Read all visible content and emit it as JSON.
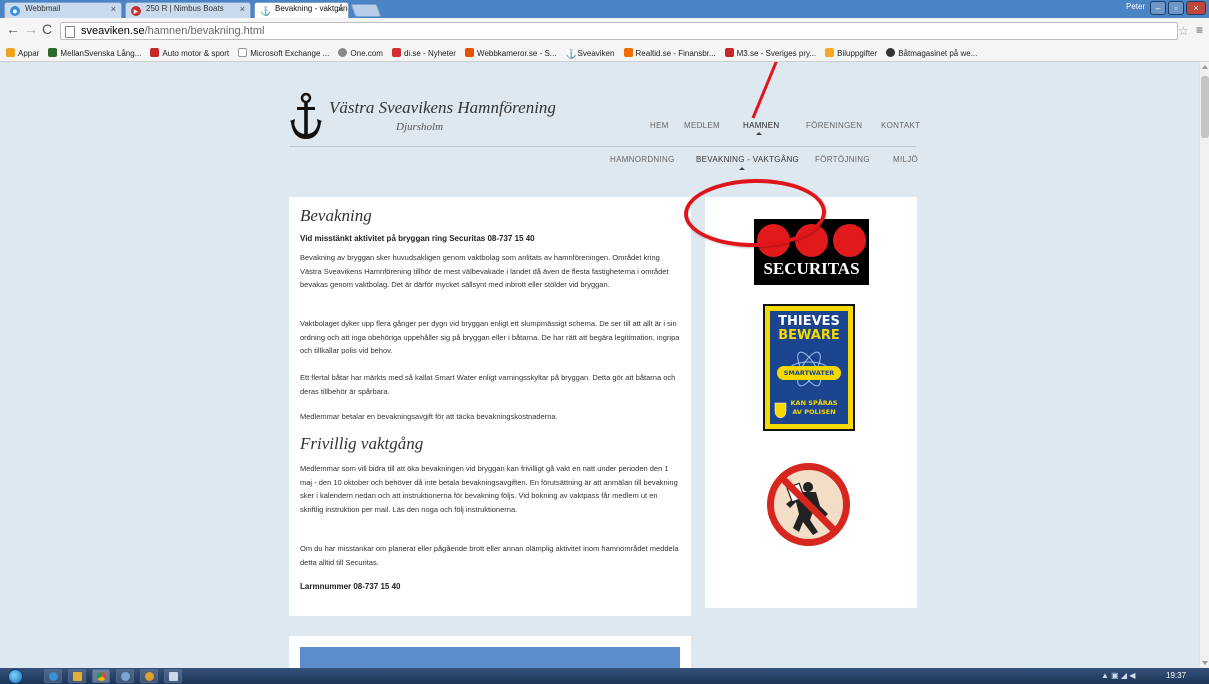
{
  "browser": {
    "tabs": [
      {
        "label": "Webbmail",
        "active": false
      },
      {
        "label": "250 R | Nimbus Boats",
        "active": false
      },
      {
        "label": "Bevakning - vaktgång",
        "active": true
      }
    ],
    "window_user": "Peter",
    "url_domain": "sveaviken.se",
    "url_path": "/hamnen/bevakning.html",
    "bookmarks": [
      "Appar",
      "MellanSvenska Lång...",
      "Auto motor & sport",
      "Microsoft Exchange ...",
      "One.com",
      "di.se - Nyheter",
      "Webbkameror.se - S...",
      "Sveaviken",
      "Realtid.se - Finansbr...",
      "M3.se - Sveriges pry...",
      "Biluppgifter",
      "Båtmagasinet på we..."
    ]
  },
  "site": {
    "title": "Västra Sveavikens Hamnförening",
    "subtitle": "Djursholm",
    "nav": [
      "HEM",
      "MEDLEM",
      "HAMNEN",
      "FÖRENINGEN",
      "KONTAKT"
    ],
    "subnav": [
      "HAMNORDNING",
      "BEVAKNING - VAKTGÅNG",
      "FÖRTÖJNING",
      "MILJÖ"
    ]
  },
  "content": {
    "h_bevakning": "Bevakning",
    "alert": "Vid misstänkt aktivitet på bryggan ring Securitas 08-737 15 40",
    "p1": "Bevakning av bryggan sker huvudsakligen genom vaktbolag som anlitats av hamnföreningen. Området kring Västra Sveavikens Hamnförening tillhör de mest välbevakade i landet då även de flesta fastigheterna i området bevakas genom vaktbolag. Det är därför mycket sällsynt med inbrott eller stölder vid bryggan.",
    "p2": "Vaktbolaget dyker upp flera gånger per dygn vid bryggan enligt ett slumpmässigt schema. De ser till att allt är i sin ordning och att inga obehöriga uppehåller sig på bryggan eller i båtarna. De har rätt att begära legitimation, ingripa och tillkallar polis vid behov.",
    "p3": "Ett flertal båtar har märkts med så kallat Smart Water enligt varningsskyltar på bryggan. Detta gör att båtarna och deras tillbehör är spårbara.",
    "p4": "Medlemmar betalar en bevakningsavgift för att täcka bevakningskostnaderna.",
    "h_frivillig": "Frivillig vaktgång",
    "p5": "Medlemmar som vill bidra till att öka bevakningen vid bryggan kan frivilligt gå vakt en natt under perioden den 1 maj - den 10 oktober och behöver då inte betala bevakningsavgiften. En förutsättning är att anmälan till bevakning sker i kalendern nedan och att instruktionerna för bevakning följs. Vid bokning av vaktpass får medlem ut en skriftlig instruktion per mail. Läs den noga och följ instruktionerna.",
    "p6": "Om du har misstankar om planerat eller pågående brott eller annan olämplig aktivitet inom hamnområdet meddela detta alltid till Securitas.",
    "larm": "Larmnummer 08-737 15 40"
  },
  "sidebar": {
    "securitas_text": "SECURITAS",
    "thieves_line1": "THIEVES",
    "thieves_line2": "BEWARE",
    "smartwater": "SMARTWATER",
    "kan_sparas": "KAN SPÅRAS",
    "av_polisen": "AV POLISEN"
  },
  "taskbar": {
    "clock": "19:37"
  },
  "colors": {
    "page_bg": "#dee8f1",
    "annotation_red": "#e0151b",
    "securitas_red": "#e31a1c",
    "smartwater_blue": "#1c4590",
    "smartwater_yellow": "#f5d900"
  }
}
